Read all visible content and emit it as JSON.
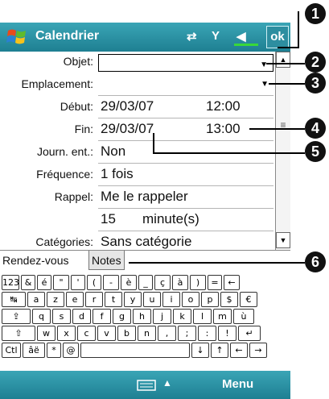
{
  "titlebar": {
    "title": "Calendrier",
    "ok_label": "ok",
    "connectivity_icon": "connectivity-icon",
    "signal_icon": "signal-icon",
    "volume_icon": "volume-icon"
  },
  "form": {
    "subject": {
      "label": "Objet:",
      "value": ""
    },
    "location": {
      "label": "Emplacement:",
      "value": ""
    },
    "start": {
      "label": "Début:",
      "date": "29/03/07",
      "time": "12:00"
    },
    "end": {
      "label": "Fin:",
      "date": "29/03/07",
      "time": "13:00"
    },
    "allday": {
      "label": "Journ. ent.:",
      "value": "Non"
    },
    "occurs": {
      "label": "Fréquence:",
      "value": "1 fois"
    },
    "reminder": {
      "label": "Rappel:",
      "value": "Me le rappeler"
    },
    "reminder_time": {
      "amount": "15",
      "unit": "minute(s)"
    },
    "categories": {
      "label": "Catégories:",
      "value": "Sans catégorie"
    }
  },
  "tabs": [
    {
      "label": "Rendez-vous"
    },
    {
      "label": "Notes"
    }
  ],
  "keyboard": {
    "row1": [
      "123",
      "&",
      "é",
      "\"",
      "'",
      "(",
      "-",
      "è",
      "_",
      "ç",
      "à",
      ")",
      "=",
      "←"
    ],
    "row2": [
      "↹",
      "a",
      "z",
      "e",
      "r",
      "t",
      "y",
      "u",
      "i",
      "o",
      "p",
      "$",
      "€"
    ],
    "row3": [
      "⇪",
      "q",
      "s",
      "d",
      "f",
      "g",
      "h",
      "j",
      "k",
      "l",
      "m",
      "ù"
    ],
    "row4": [
      "⇧",
      "w",
      "x",
      "c",
      "v",
      "b",
      "n",
      ",",
      ";",
      ":",
      "!",
      "↵"
    ],
    "row5": [
      "Ctl",
      "âë",
      "*",
      "@",
      " ",
      "↓",
      "↑",
      "←",
      "→"
    ]
  },
  "bottombar": {
    "menu_label": "Menu",
    "sip_icon": "keyboard-icon"
  },
  "callouts": [
    "1",
    "2",
    "3",
    "4",
    "5",
    "6"
  ]
}
